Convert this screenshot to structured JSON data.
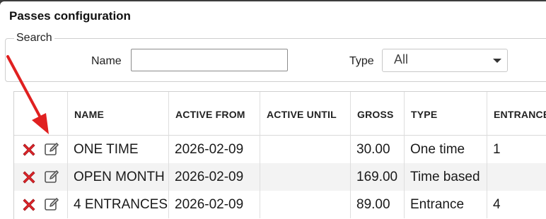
{
  "window": {
    "title": "Passes configuration"
  },
  "search": {
    "legend": "Search",
    "name_label": "Name",
    "name_value": "",
    "type_label": "Type",
    "type_value": "All"
  },
  "table": {
    "columns": [
      "NAME",
      "ACTIVE FROM",
      "ACTIVE UNTIL",
      "GROSS",
      "TYPE",
      "ENTRANCES"
    ],
    "rows": [
      {
        "name": "ONE TIME",
        "active_from": "2026-02-09",
        "active_until": "",
        "gross": "30.00",
        "type": "One time",
        "entrances": "1"
      },
      {
        "name": "OPEN MONTH",
        "active_from": "2026-02-09",
        "active_until": "",
        "gross": "169.00",
        "type": "Time based",
        "entrances": ""
      },
      {
        "name": "4 ENTRANCES",
        "active_from": "2026-02-09",
        "active_until": "",
        "gross": "89.00",
        "type": "Entrance",
        "entrances": "4"
      }
    ]
  },
  "colors": {
    "delete_icon": "#e0262a",
    "edit_icon": "#555555",
    "annotation_arrow": "#e02020",
    "row_alt": "#f3f3f3"
  },
  "icons": {
    "delete": "red-x-icon",
    "edit": "edit-pencil-icon",
    "annotation": "red-arrow"
  }
}
